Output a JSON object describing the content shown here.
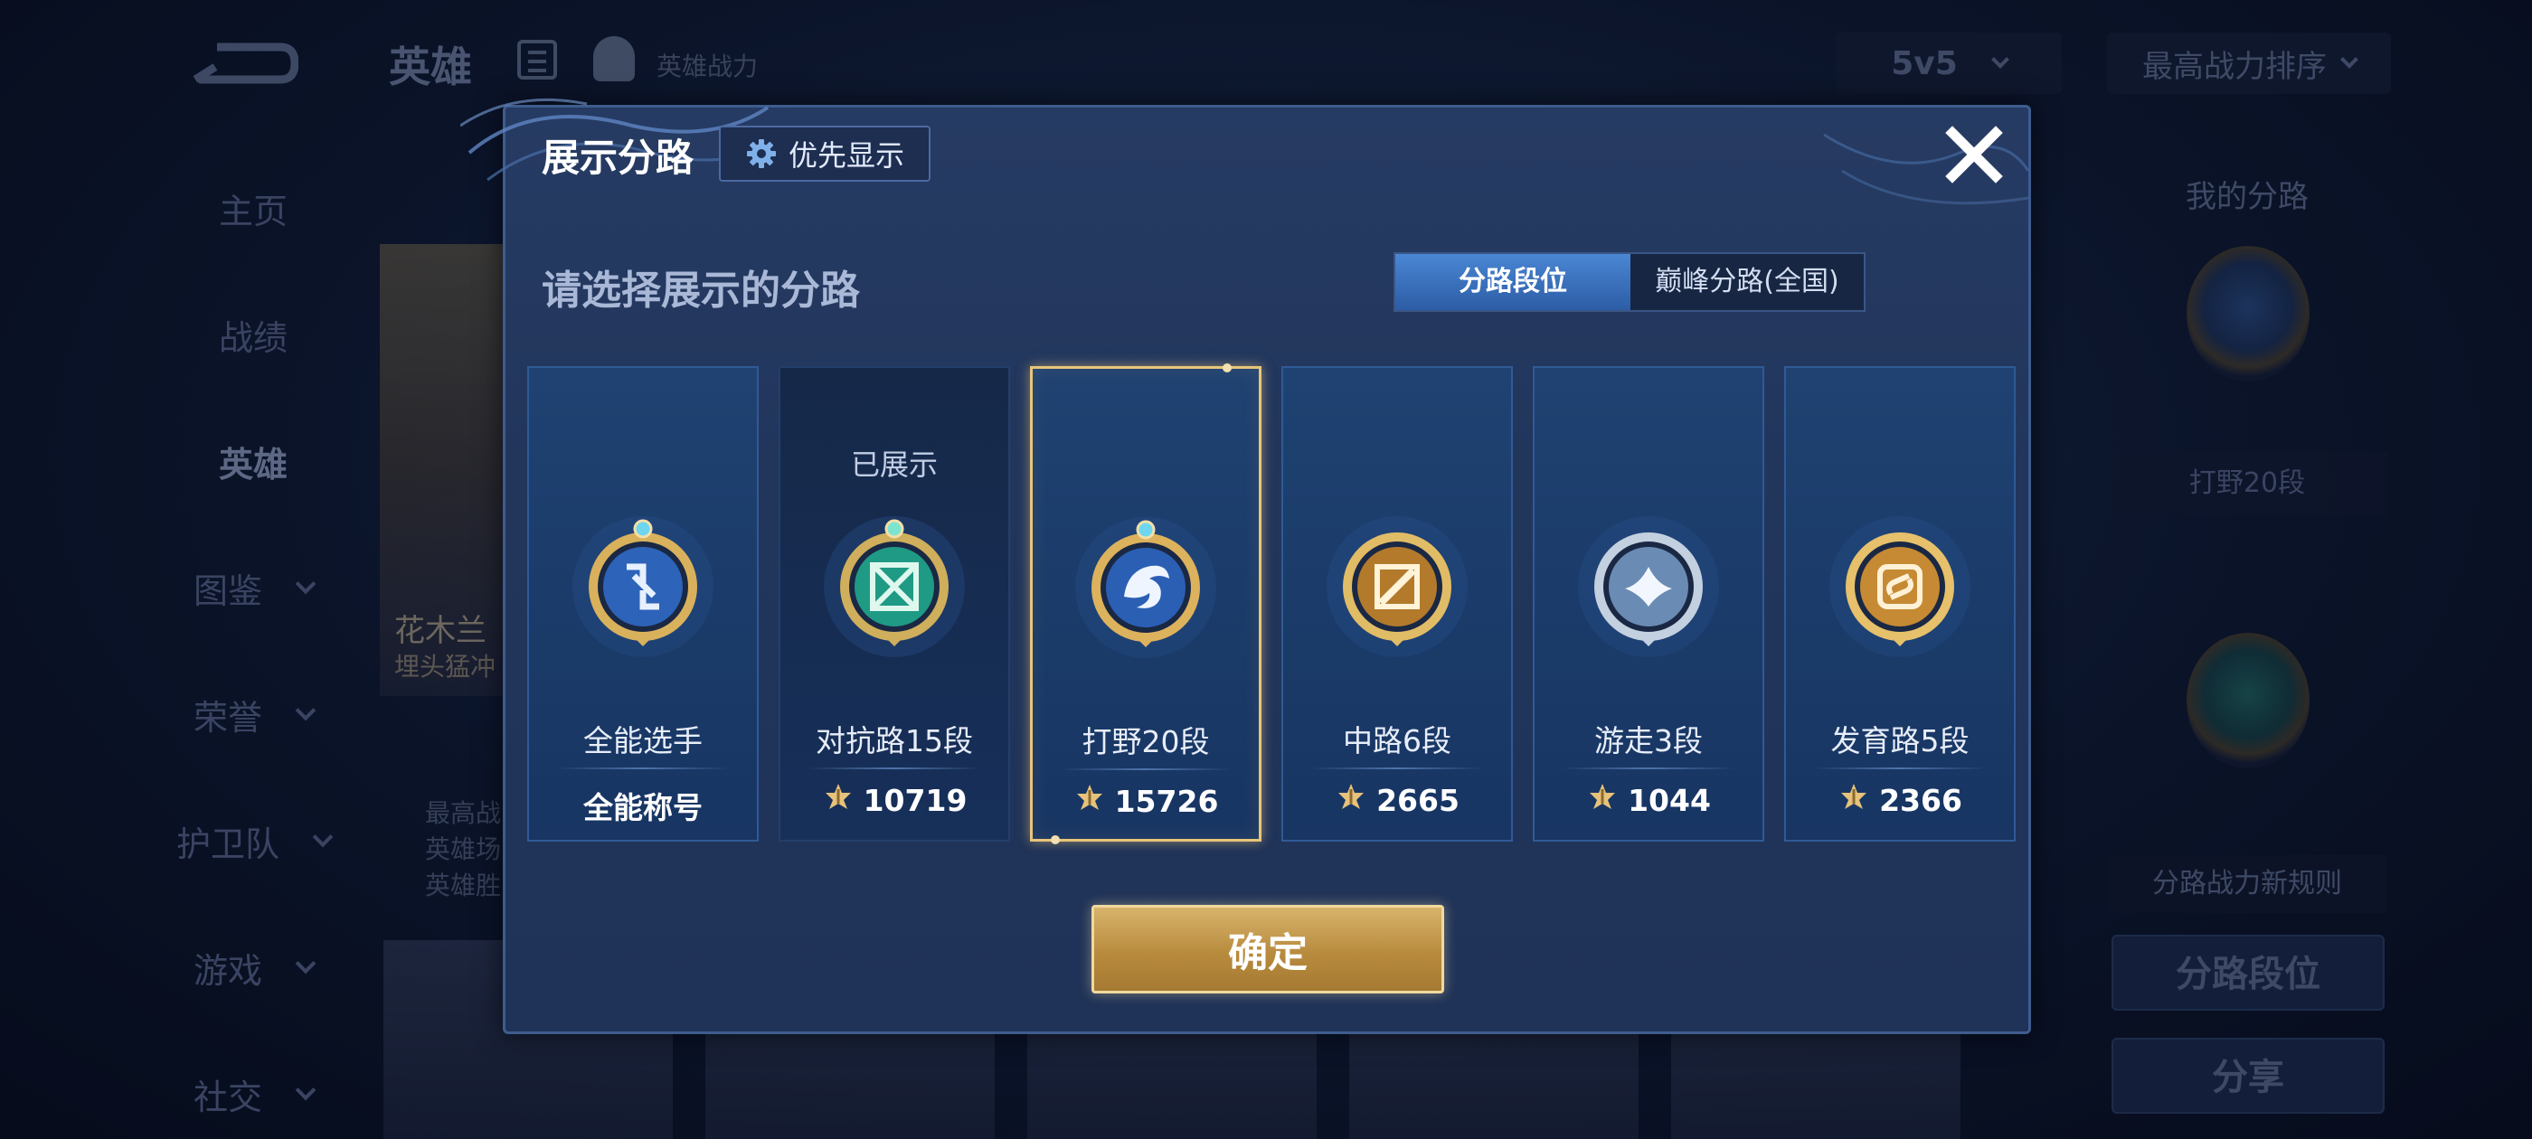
{
  "background": {
    "title": "英雄",
    "subtitle": "英雄战力",
    "mode_select": "5v5",
    "sort_select": "最高战力排序",
    "sidebar": [
      {
        "label": "主页",
        "has_chevron": false
      },
      {
        "label": "战绩",
        "has_chevron": false
      },
      {
        "label": "英雄",
        "has_chevron": false,
        "active": true
      },
      {
        "label": "图鉴",
        "has_chevron": true
      },
      {
        "label": "荣誉",
        "has_chevron": true
      },
      {
        "label": "护卫队",
        "has_chevron": true
      },
      {
        "label": "游戏",
        "has_chevron": true
      },
      {
        "label": "社交",
        "has_chevron": true
      }
    ],
    "hero_card": {
      "name": "花木兰",
      "sub": "埋头猛冲"
    },
    "hero_stats": [
      "最高战",
      "英雄场",
      "英雄胜"
    ],
    "right_panel": {
      "title": "我的分路",
      "lane_label": "打野20段",
      "rule_link": "分路战力新规则",
      "lane_button": "分路段位",
      "share_button": "分享"
    }
  },
  "modal": {
    "title": "展示分路",
    "priority_button": "优先显示",
    "subtitle": "请选择展示的分路",
    "segments": [
      {
        "label": "分路段位",
        "active": true
      },
      {
        "label": "巅峰分路(全国)",
        "active": false
      }
    ],
    "cards": [
      {
        "name": "全能选手",
        "value": "全能称号",
        "value_is_title": true,
        "state": "normal",
        "badge": "allround",
        "icon": "diamond-emblem-icon"
      },
      {
        "name": "对抗路15段",
        "value": "10719",
        "value_is_title": false,
        "state": "shown",
        "shown_label": "已展示",
        "badge": "clash",
        "icon": "crossed-swords-emblem-icon"
      },
      {
        "name": "打野20段",
        "value": "15726",
        "value_is_title": false,
        "state": "selected",
        "badge": "jungle",
        "icon": "dragon-emblem-icon"
      },
      {
        "name": "中路6段",
        "value": "2665",
        "value_is_title": false,
        "state": "normal",
        "badge": "mid",
        "icon": "mid-lane-emblem-icon"
      },
      {
        "name": "游走3段",
        "value": "1044",
        "value_is_title": false,
        "state": "normal",
        "badge": "roam",
        "icon": "wings-emblem-icon"
      },
      {
        "name": "发育路5段",
        "value": "2366",
        "value_is_title": false,
        "state": "normal",
        "badge": "farm",
        "icon": "farm-lane-emblem-icon"
      }
    ],
    "confirm_button": "确定"
  },
  "colors": {
    "gold_accent": "#e8c579",
    "segment_active": "#3d76c4",
    "confirm_gold": "#c79b4f"
  }
}
